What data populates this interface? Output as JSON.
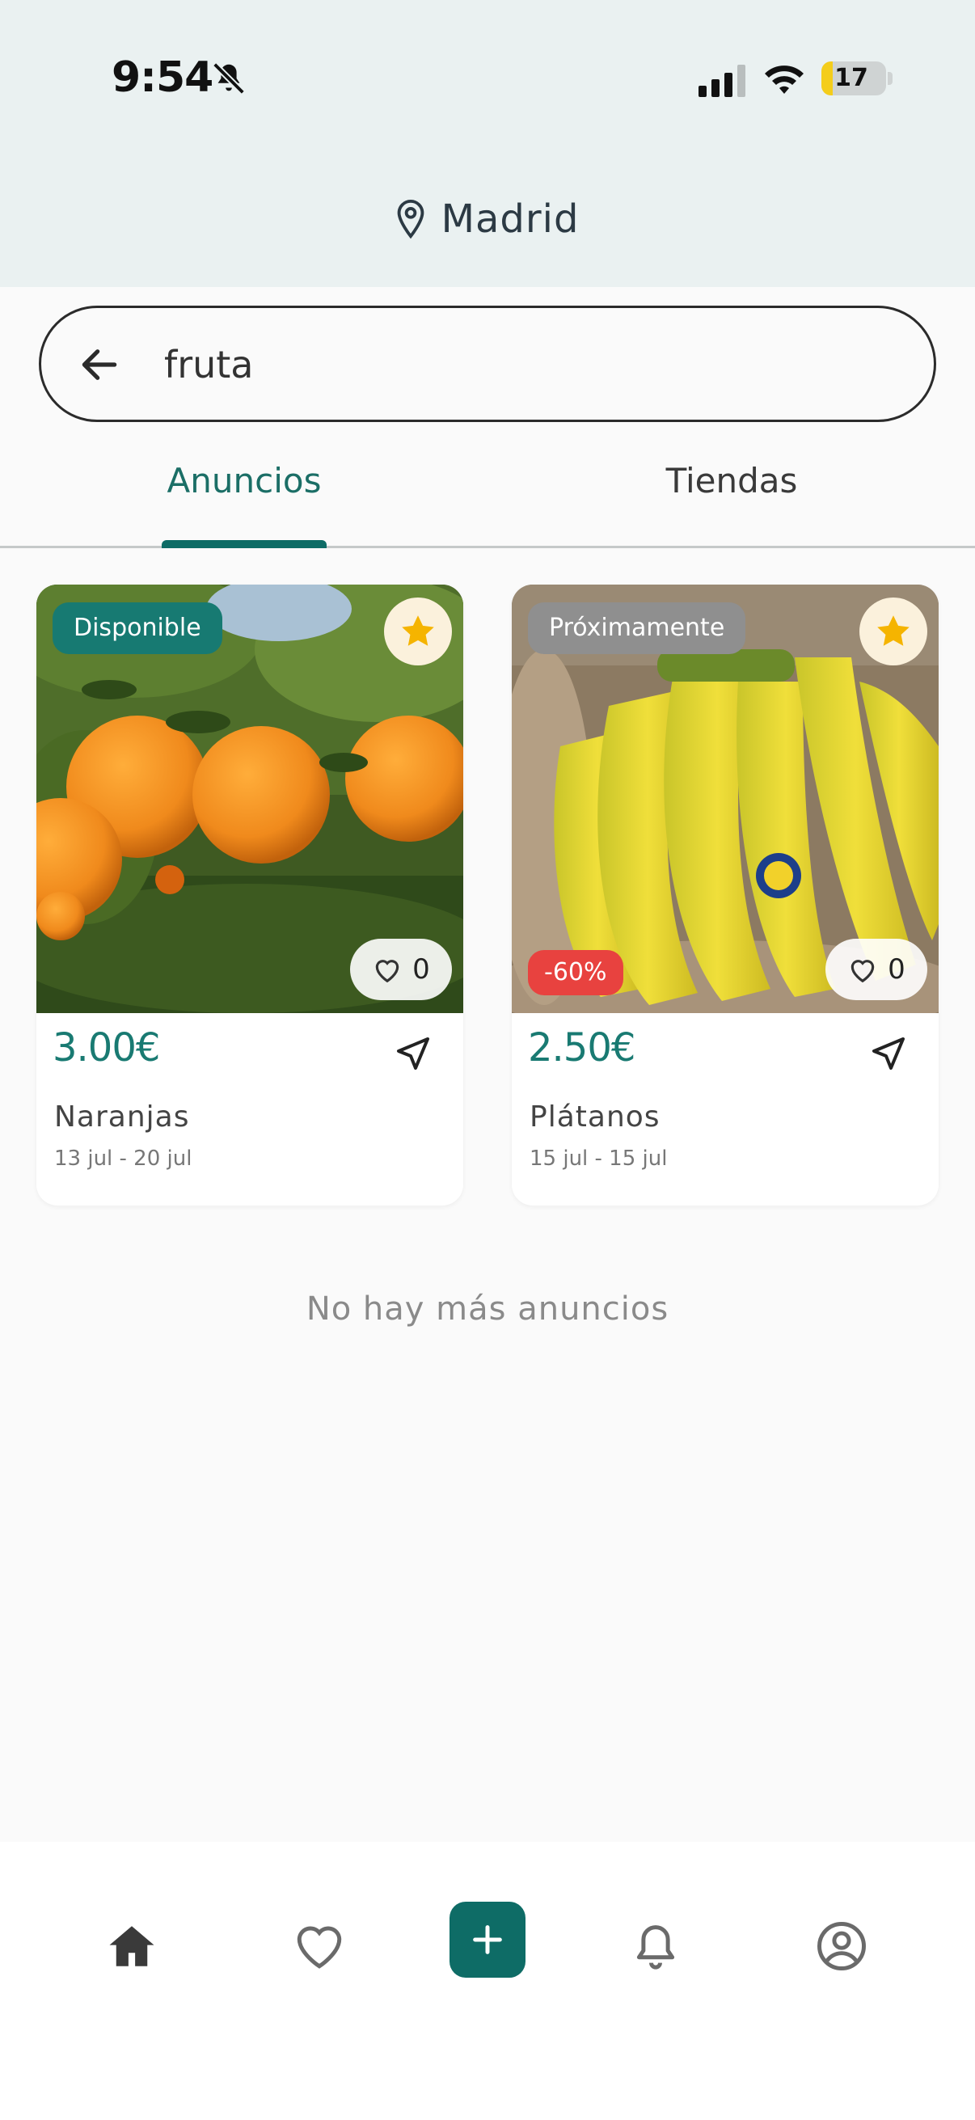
{
  "status_bar": {
    "time": "9:54",
    "battery": "17",
    "battery_level": 0.17
  },
  "header": {
    "location": "Madrid"
  },
  "search": {
    "value": "fruta",
    "placeholder": ""
  },
  "tabs": [
    {
      "label": "Anuncios",
      "active": true
    },
    {
      "label": "Tiendas",
      "active": false
    }
  ],
  "listings": [
    {
      "status": "Disponible",
      "status_color": "#177a72",
      "discount": "",
      "likes": "0",
      "price": "3.00€",
      "name": "Naranjas",
      "dates": "13 jul - 20 jul",
      "image": "oranges-on-tree"
    },
    {
      "status": "Próximamente",
      "status_color": "#8f8f8f",
      "discount": "-60%",
      "likes": "0",
      "price": "2.50€",
      "name": "Plátanos",
      "dates": "15 jul - 15 jul",
      "image": "banana-bunch"
    }
  ],
  "end_message": "No hay más anuncios",
  "colors": {
    "accent": "#0e6c66",
    "price": "#197a72",
    "star": "#f5b400",
    "discount": "#e8423f"
  },
  "bottom_nav": [
    "home-icon",
    "heart-icon",
    "add-icon",
    "bell-icon",
    "profile-icon"
  ]
}
